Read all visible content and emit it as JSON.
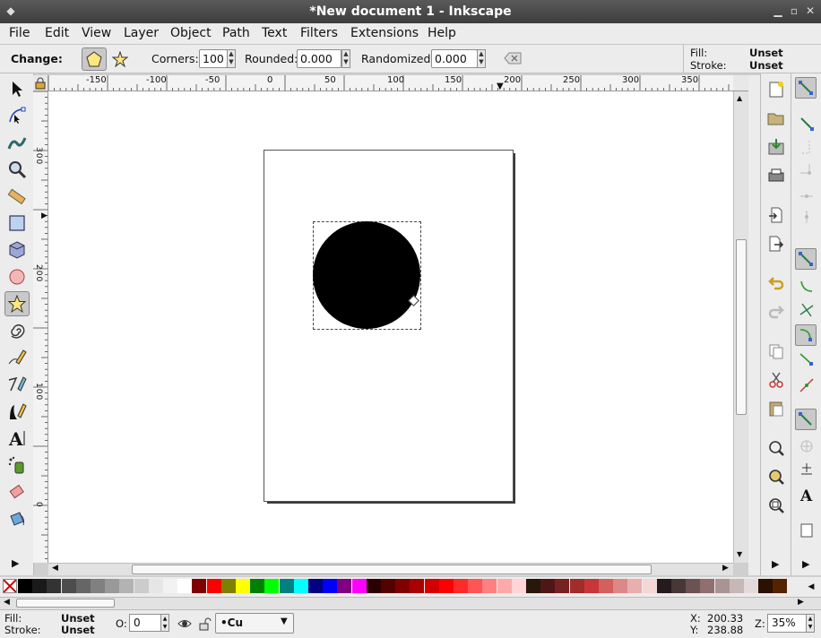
{
  "window": {
    "title": "*New document 1 - Inkscape"
  },
  "menu": [
    "File",
    "Edit",
    "View",
    "Layer",
    "Object",
    "Path",
    "Text",
    "Filters",
    "Extensions",
    "Help"
  ],
  "tool_controls": {
    "change_label": "Change:",
    "corners_label": "Corners:",
    "corners_value": "100",
    "rounded_label": "Rounded:",
    "rounded_value": "0.000",
    "randomized_label": "Randomized:",
    "randomized_value": "0.000",
    "fill_label": "Fill:",
    "fill_value": "Unset",
    "stroke_label": "Stroke:",
    "stroke_value": "Unset"
  },
  "rulers": {
    "horizontal_ticks": [
      "-150",
      "-100",
      "-50",
      "0",
      "50",
      "100",
      "150",
      "200",
      "250",
      "300",
      "350"
    ],
    "vertical_ticks": [
      "300",
      "200",
      "100",
      "0"
    ]
  },
  "tools": [
    "selector-icon",
    "node-icon",
    "tweak-icon",
    "zoom-icon",
    "measure-icon",
    "rectangle-icon",
    "3d-box-icon",
    "ellipse-icon",
    "star-icon",
    "spiral-icon",
    "pencil-icon",
    "pen-icon",
    "calligraphy-icon",
    "text-icon",
    "spray-icon",
    "eraser-icon",
    "paint-bucket-icon"
  ],
  "active_tool": "star-icon",
  "palette": [
    "#000000",
    "#1a1a1a",
    "#333333",
    "#4d4d4d",
    "#666666",
    "#808080",
    "#999999",
    "#b3b3b3",
    "#cccccc",
    "#e6e6e6",
    "#f2f2f2",
    "#ffffff",
    "#800000",
    "#ff0000",
    "#808000",
    "#ffff00",
    "#008000",
    "#00ff00",
    "#008080",
    "#00ffff",
    "#000080",
    "#0000ff",
    "#800080",
    "#ff00ff",
    "#2b0000",
    "#550000",
    "#800000",
    "#aa0000",
    "#d40000",
    "#ff0000",
    "#ff2a2a",
    "#ff5555",
    "#ff8080",
    "#ffaaaa",
    "#ffd5d5",
    "#28170b",
    "#501616",
    "#782121",
    "#a02c2c",
    "#c83737",
    "#d35f5f",
    "#de8787",
    "#e9afaf",
    "#f4d7d7",
    "#241c1c",
    "#483737",
    "#6c5353",
    "#916f6f",
    "#ac9393",
    "#c8b7b7",
    "#e3dbdb",
    "#2b1100",
    "#552200"
  ],
  "status": {
    "fill_label": "Fill:",
    "fill_value": "Unset",
    "stroke_label": "Stroke:",
    "stroke_value": "Unset",
    "opacity_label": "O:",
    "opacity_value": "0",
    "layer_value": "•Cu",
    "x_label": "X:",
    "x_value": "200.33",
    "y_label": "Y:",
    "y_value": "238.88",
    "zoom_label": "Z:",
    "zoom_value": "35%"
  }
}
